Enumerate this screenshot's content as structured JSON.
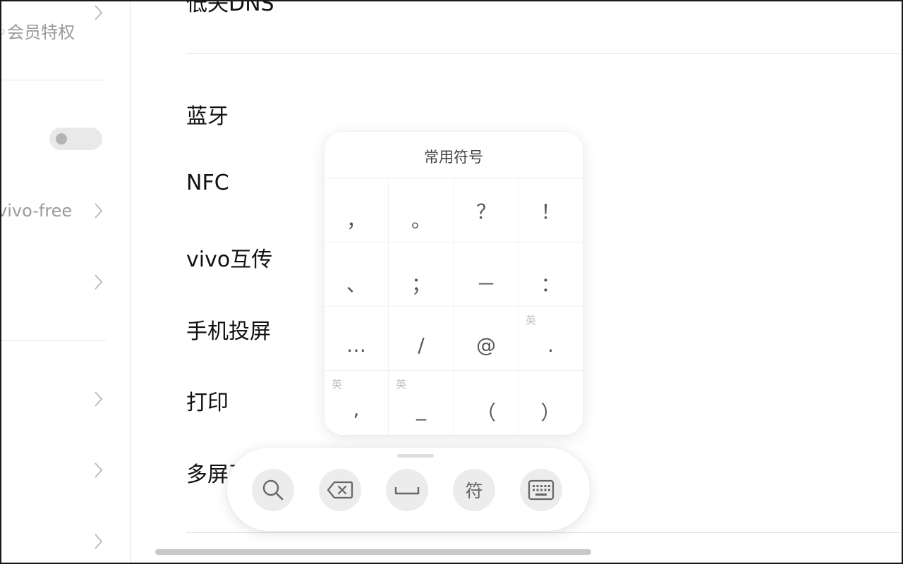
{
  "left_pane": {
    "member_privilege": "会员特权",
    "wifi_name": "vivo-free"
  },
  "main": {
    "cutoff_label": "低失DNS",
    "rows": [
      {
        "label": "蓝牙"
      },
      {
        "label": "NFC"
      },
      {
        "label": "vivo互传"
      },
      {
        "label": "手机投屏"
      },
      {
        "label": "打印"
      },
      {
        "label": "多屏互"
      }
    ]
  },
  "symbols_panel": {
    "title": "常用符号",
    "symbols": [
      {
        "char": "，",
        "tag": ""
      },
      {
        "char": "。",
        "tag": ""
      },
      {
        "char": "？",
        "tag": ""
      },
      {
        "char": "！",
        "tag": ""
      },
      {
        "char": "、",
        "tag": ""
      },
      {
        "char": "；",
        "tag": ""
      },
      {
        "char": "－",
        "tag": ""
      },
      {
        "char": "：",
        "tag": ""
      },
      {
        "char": "…",
        "tag": ""
      },
      {
        "char": "/",
        "tag": ""
      },
      {
        "char": "@",
        "tag": ""
      },
      {
        "char": ".",
        "tag": "英"
      },
      {
        "char": ",",
        "tag": "英"
      },
      {
        "char": "_",
        "tag": "英"
      },
      {
        "char": "（",
        "tag": ""
      },
      {
        "char": "）",
        "tag": ""
      }
    ]
  },
  "toolbar": {
    "symbols_label": "符",
    "icons": [
      "search-icon",
      "backspace-icon",
      "space-icon",
      "symbols-icon",
      "keyboard-icon"
    ]
  },
  "colors": {
    "panel_bg": "#ffffff",
    "button_bg": "#ececec",
    "muted_text": "#9a9a9a",
    "divider": "#e3e3e3"
  }
}
